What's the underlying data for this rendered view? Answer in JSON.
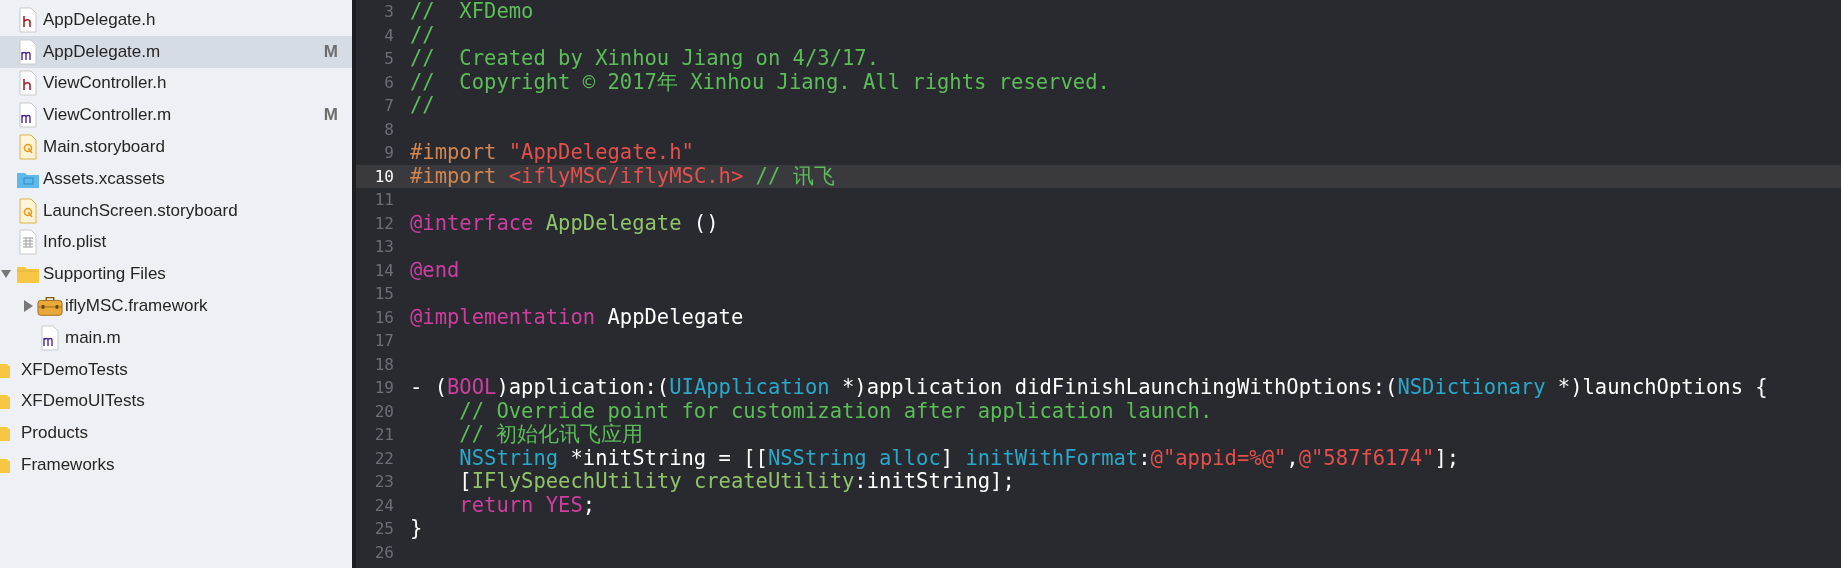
{
  "navigator": {
    "items": [
      {
        "children": [
          {
            "label": "AppDelegate.h",
            "kind": "h",
            "selected": false
          },
          {
            "label": "AppDelegate.m",
            "kind": "m",
            "selected": true,
            "status": "M"
          },
          {
            "label": "ViewController.h",
            "kind": "h",
            "selected": false
          },
          {
            "label": "ViewController.m",
            "kind": "m",
            "selected": false,
            "status": "M"
          },
          {
            "label": "Main.storyboard",
            "kind": "storyboard",
            "selected": false
          },
          {
            "label": "Assets.xcassets",
            "kind": "xcassets",
            "selected": false
          },
          {
            "label": "LaunchScreen.storyboard",
            "kind": "storyboard",
            "selected": false
          },
          {
            "label": "Info.plist",
            "kind": "plist",
            "selected": false
          },
          {
            "label": "Supporting Files",
            "kind": "folder",
            "selected": false,
            "expanded": true,
            "children": [
              {
                "label": "iflyMSC.framework",
                "kind": "framework",
                "selected": false,
                "expanded": false
              },
              {
                "label": "main.m",
                "kind": "m",
                "selected": false
              }
            ]
          }
        ]
      },
      {
        "label": "XFDemoTests",
        "kind": "folder",
        "selected": false
      },
      {
        "label": "XFDemoUITests",
        "kind": "folder",
        "selected": false
      },
      {
        "label": "Products",
        "kind": "folder",
        "selected": false
      },
      {
        "label": "Frameworks",
        "kind": "folder",
        "selected": false
      }
    ]
  },
  "editor": {
    "lines": [
      {
        "number": "3",
        "current": false,
        "segments": [
          {
            "text": "//  XFDemo",
            "kind": "comment"
          }
        ]
      },
      {
        "number": "4",
        "current": false,
        "segments": [
          {
            "text": "//",
            "kind": "comment"
          }
        ]
      },
      {
        "number": "5",
        "current": false,
        "segments": [
          {
            "text": "//  Created by Xinhou Jiang on 4/3/17.",
            "kind": "comment"
          }
        ]
      },
      {
        "number": "6",
        "current": false,
        "segments": [
          {
            "text": "//  Copyright © 2017年 Xinhou Jiang. All rights reserved.",
            "kind": "comment"
          }
        ]
      },
      {
        "number": "7",
        "current": false,
        "segments": [
          {
            "text": "//",
            "kind": "comment"
          }
        ]
      },
      {
        "number": "8",
        "current": false
      },
      {
        "number": "9",
        "current": false,
        "segments": [
          {
            "text": "#import ",
            "kind": "preprocessor"
          },
          {
            "text": "\"AppDelegate.h\"",
            "kind": "string"
          }
        ]
      },
      {
        "number": "10",
        "current": true,
        "segments": [
          {
            "text": "#import ",
            "kind": "preprocessor"
          },
          {
            "text": "<iflyMSC/iflyMSC.h>",
            "kind": "string"
          },
          {
            "text": " // 讯飞",
            "kind": "comment"
          }
        ]
      },
      {
        "number": "11",
        "current": false
      },
      {
        "number": "12",
        "current": false,
        "segments": [
          {
            "text": "@interface ",
            "kind": "keyword"
          },
          {
            "text": "AppDelegate",
            "kind": "project"
          },
          {
            "text": " ()",
            "kind": "plain"
          }
        ]
      },
      {
        "number": "13",
        "current": false
      },
      {
        "number": "14",
        "current": false,
        "segments": [
          {
            "text": "@end",
            "kind": "keyword"
          }
        ]
      },
      {
        "number": "15",
        "current": false
      },
      {
        "number": "16",
        "current": false,
        "segments": [
          {
            "text": "@implementation",
            "kind": "keyword"
          },
          {
            "text": " AppDelegate",
            "kind": "plain"
          }
        ]
      },
      {
        "number": "17",
        "current": false
      },
      {
        "number": "18",
        "current": false
      },
      {
        "number": "19",
        "current": false,
        "segments": [
          {
            "text": "- (",
            "kind": "plain"
          },
          {
            "text": "BOOL",
            "kind": "keyword"
          },
          {
            "text": ")application:(",
            "kind": "plain"
          },
          {
            "text": "UIApplication",
            "kind": "type"
          },
          {
            "text": " *)application didFinishLaunchingWithOptions:(",
            "kind": "plain"
          },
          {
            "text": "NSDictionary",
            "kind": "type"
          },
          {
            "text": " *)launchOptions {",
            "kind": "plain"
          }
        ]
      },
      {
        "number": "20",
        "current": false,
        "segments": [
          {
            "text": "    // Override point for customization after application launch.",
            "kind": "comment"
          }
        ]
      },
      {
        "number": "21",
        "current": false,
        "segments": [
          {
            "text": "    // 初始化讯飞应用",
            "kind": "comment"
          }
        ]
      },
      {
        "number": "22",
        "current": false,
        "segments": [
          {
            "text": "    NSString",
            "kind": "type"
          },
          {
            "text": " *initString = [[",
            "kind": "plain"
          },
          {
            "text": "NSString alloc",
            "kind": "type"
          },
          {
            "text": "] ",
            "kind": "plain"
          },
          {
            "text": "initWithFormat",
            "kind": "type"
          },
          {
            "text": ":",
            "kind": "plain"
          },
          {
            "text": "@\"appid=%@\"",
            "kind": "string"
          },
          {
            "text": ",",
            "kind": "plain"
          },
          {
            "text": "@\"587f6174\"",
            "kind": "string"
          },
          {
            "text": "];",
            "kind": "plain"
          }
        ]
      },
      {
        "number": "23",
        "current": false,
        "segments": [
          {
            "text": "    [",
            "kind": "plain"
          },
          {
            "text": "IFlySpeechUtility createUtility",
            "kind": "project"
          },
          {
            "text": ":initString];",
            "kind": "plain"
          }
        ]
      },
      {
        "number": "24",
        "current": false,
        "segments": [
          {
            "text": "    return YES",
            "kind": "keyword"
          },
          {
            "text": ";",
            "kind": "plain"
          }
        ]
      },
      {
        "number": "25",
        "current": false,
        "segments": [
          {
            "text": "}",
            "kind": "plain"
          }
        ]
      },
      {
        "number": "26",
        "current": false
      }
    ]
  }
}
